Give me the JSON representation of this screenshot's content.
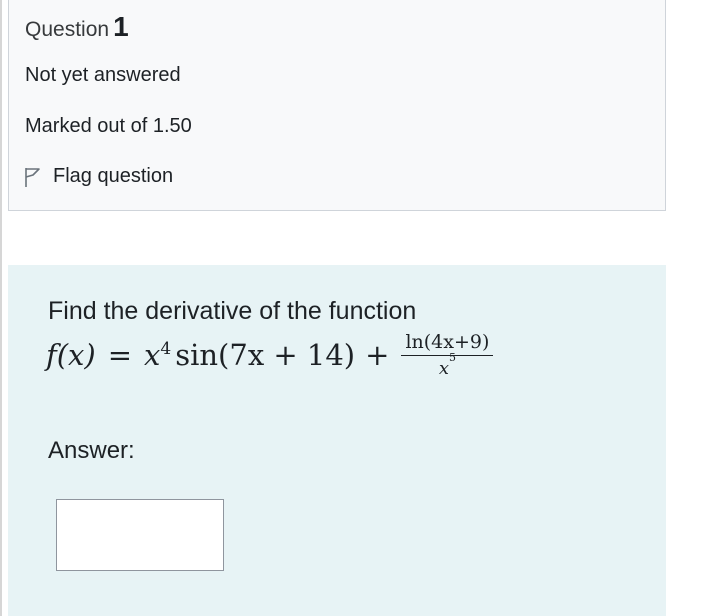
{
  "question": {
    "title_prefix": "Question",
    "number": "1",
    "state": "Not yet answered",
    "grade": "Marked out of 1.50",
    "flag_label": "Flag question",
    "flag_icon": "flag-outline-icon"
  },
  "content": {
    "prompt": "Find the derivative of the function",
    "formula": {
      "lhs": "f(x)",
      "equals": "=",
      "term1_base": "x",
      "term1_exp": "4",
      "term1_rest": "sin(7x + 14)",
      "plus": "+",
      "frac_numerator": "ln(4x+9)",
      "frac_denominator_base": "x",
      "frac_denominator_exp": "5"
    },
    "answer_label": "Answer:",
    "answer_value": ""
  }
}
